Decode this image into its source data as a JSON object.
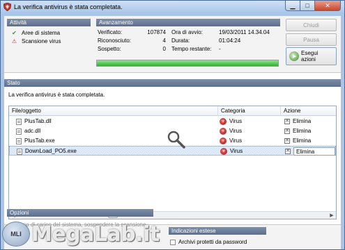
{
  "window": {
    "title": "La verifica antivirus è stata completata."
  },
  "activity": {
    "header": "Attività",
    "items": [
      {
        "label": "Aree di sistema",
        "icon": "check-icon"
      },
      {
        "label": "Scansione virus",
        "icon": "warning-icon"
      }
    ]
  },
  "progress": {
    "header": "Avanzamento",
    "verificati_label": "Verificato:",
    "verificati_value": "107874",
    "riconosciuto_label": "Riconosciuto:",
    "riconosciuto_value": "4",
    "sospetto_label": "Sospetto:",
    "sospetto_value": "0",
    "ora_avvio_label": "Ora di avvio:",
    "ora_avvio_value": "19/03/2011 14.34.04",
    "durata_label": "Durata:",
    "durata_value": "01:04:24",
    "tempo_label": "Tempo restante:",
    "tempo_value": "-",
    "percent": 100
  },
  "buttons": {
    "chiudi": "Chiudi",
    "pausa": "Pausa",
    "esegui_line1": "Esegui",
    "esegui_line2": "azioni"
  },
  "stato": {
    "header": "Stato",
    "message": "La verifica antivirus è stata completata."
  },
  "table": {
    "columns": [
      "File/oggetto",
      "Categoria",
      "Azione"
    ],
    "rows": [
      {
        "file": "PlusTab.dll",
        "category": "Virus",
        "action": "Elimina"
      },
      {
        "file": "adc.dll",
        "category": "Virus",
        "action": "Elimina"
      },
      {
        "file": "PlusTab.exe",
        "category": "Virus",
        "action": "Elimina"
      },
      {
        "file": "DownLoad_PO5.exe",
        "category": "Virus",
        "action": "Elimina"
      }
    ]
  },
  "options": {
    "header": "Opzioni",
    "line1": "In caso di carico del sistema, sospendere la scansione",
    "line2": "virus"
  },
  "extended": {
    "header": "Indicazioni estese",
    "checkbox_label": "Archivi protetti da password"
  },
  "watermark": {
    "badge": "MLI",
    "text": "MegaLab.it"
  }
}
